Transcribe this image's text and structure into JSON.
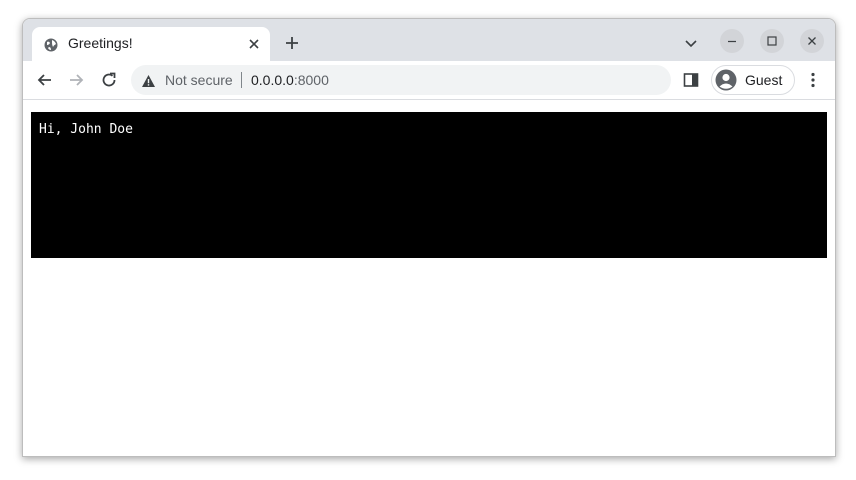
{
  "tab": {
    "title": "Greetings!",
    "favicon": "globe-icon"
  },
  "toolbar": {
    "security_label": "Not secure",
    "url_host": "0.0.0.0",
    "url_port": ":8000",
    "profile_name": "Guest"
  },
  "page": {
    "greeting": "Hi, John Doe",
    "box_color": "#000000",
    "text_color": "#ffffff"
  }
}
